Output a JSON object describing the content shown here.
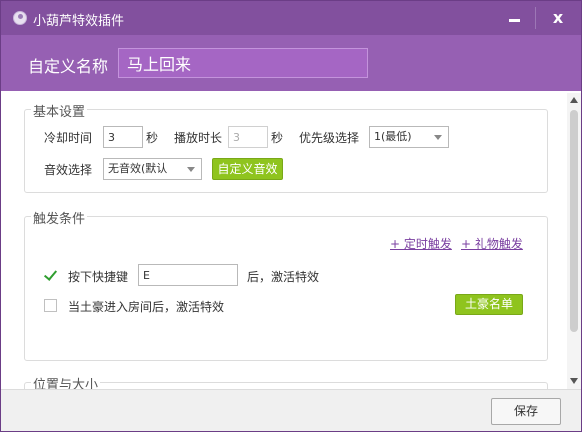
{
  "titlebar": {
    "title": "小葫芦特效插件",
    "close_label": "x"
  },
  "header": {
    "name_label": "自定义名称",
    "name_value": "马上回来"
  },
  "basic": {
    "title": "基本设置",
    "cooldown_label": "冷却时间",
    "cooldown_value": "3",
    "cooldown_unit": "秒",
    "duration_label": "播放时长",
    "duration_value": "3",
    "duration_unit": "秒",
    "priority_label": "优先级选择",
    "priority_value": "1(最低)",
    "sound_label": "音效选择",
    "sound_value": "无音效(默认",
    "custom_sound_label": "自定义音效"
  },
  "trigger": {
    "title": "触发条件",
    "timed_trigger_label": "+ 定时触发",
    "gift_trigger_label": "+ 礼物触发",
    "hotkey_checked": true,
    "hotkey_label": "按下快捷键",
    "hotkey_value": "E",
    "hotkey_suffix": "后，激活特效",
    "tycoon_checked": false,
    "tycoon_label": "当土豪进入房间后，激活特效",
    "tycoon_list_label": "土豪名单"
  },
  "position": {
    "title": "位置与大小"
  },
  "footer": {
    "save_label": "保存"
  },
  "colors": {
    "titlebar": "#82509e",
    "header": "#9660b3",
    "accent_green": "#8fc41e",
    "link": "#7a3fa0",
    "check": "#2f9e2f"
  }
}
